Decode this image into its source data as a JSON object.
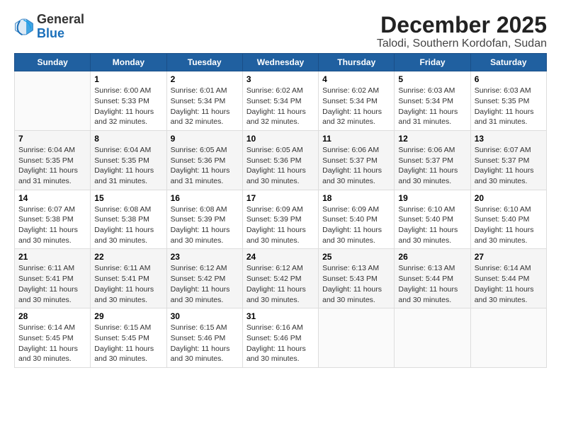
{
  "logo": {
    "general": "General",
    "blue": "Blue"
  },
  "title": "December 2025",
  "subtitle": "Talodi, Southern Kordofan, Sudan",
  "days_header": [
    "Sunday",
    "Monday",
    "Tuesday",
    "Wednesday",
    "Thursday",
    "Friday",
    "Saturday"
  ],
  "weeks": [
    [
      {
        "day": "",
        "info": ""
      },
      {
        "day": "1",
        "info": "Sunrise: 6:00 AM\nSunset: 5:33 PM\nDaylight: 11 hours\nand 32 minutes."
      },
      {
        "day": "2",
        "info": "Sunrise: 6:01 AM\nSunset: 5:34 PM\nDaylight: 11 hours\nand 32 minutes."
      },
      {
        "day": "3",
        "info": "Sunrise: 6:02 AM\nSunset: 5:34 PM\nDaylight: 11 hours\nand 32 minutes."
      },
      {
        "day": "4",
        "info": "Sunrise: 6:02 AM\nSunset: 5:34 PM\nDaylight: 11 hours\nand 32 minutes."
      },
      {
        "day": "5",
        "info": "Sunrise: 6:03 AM\nSunset: 5:34 PM\nDaylight: 11 hours\nand 31 minutes."
      },
      {
        "day": "6",
        "info": "Sunrise: 6:03 AM\nSunset: 5:35 PM\nDaylight: 11 hours\nand 31 minutes."
      }
    ],
    [
      {
        "day": "7",
        "info": "Sunrise: 6:04 AM\nSunset: 5:35 PM\nDaylight: 11 hours\nand 31 minutes."
      },
      {
        "day": "8",
        "info": "Sunrise: 6:04 AM\nSunset: 5:35 PM\nDaylight: 11 hours\nand 31 minutes."
      },
      {
        "day": "9",
        "info": "Sunrise: 6:05 AM\nSunset: 5:36 PM\nDaylight: 11 hours\nand 31 minutes."
      },
      {
        "day": "10",
        "info": "Sunrise: 6:05 AM\nSunset: 5:36 PM\nDaylight: 11 hours\nand 30 minutes."
      },
      {
        "day": "11",
        "info": "Sunrise: 6:06 AM\nSunset: 5:37 PM\nDaylight: 11 hours\nand 30 minutes."
      },
      {
        "day": "12",
        "info": "Sunrise: 6:06 AM\nSunset: 5:37 PM\nDaylight: 11 hours\nand 30 minutes."
      },
      {
        "day": "13",
        "info": "Sunrise: 6:07 AM\nSunset: 5:37 PM\nDaylight: 11 hours\nand 30 minutes."
      }
    ],
    [
      {
        "day": "14",
        "info": "Sunrise: 6:07 AM\nSunset: 5:38 PM\nDaylight: 11 hours\nand 30 minutes."
      },
      {
        "day": "15",
        "info": "Sunrise: 6:08 AM\nSunset: 5:38 PM\nDaylight: 11 hours\nand 30 minutes."
      },
      {
        "day": "16",
        "info": "Sunrise: 6:08 AM\nSunset: 5:39 PM\nDaylight: 11 hours\nand 30 minutes."
      },
      {
        "day": "17",
        "info": "Sunrise: 6:09 AM\nSunset: 5:39 PM\nDaylight: 11 hours\nand 30 minutes."
      },
      {
        "day": "18",
        "info": "Sunrise: 6:09 AM\nSunset: 5:40 PM\nDaylight: 11 hours\nand 30 minutes."
      },
      {
        "day": "19",
        "info": "Sunrise: 6:10 AM\nSunset: 5:40 PM\nDaylight: 11 hours\nand 30 minutes."
      },
      {
        "day": "20",
        "info": "Sunrise: 6:10 AM\nSunset: 5:40 PM\nDaylight: 11 hours\nand 30 minutes."
      }
    ],
    [
      {
        "day": "21",
        "info": "Sunrise: 6:11 AM\nSunset: 5:41 PM\nDaylight: 11 hours\nand 30 minutes."
      },
      {
        "day": "22",
        "info": "Sunrise: 6:11 AM\nSunset: 5:41 PM\nDaylight: 11 hours\nand 30 minutes."
      },
      {
        "day": "23",
        "info": "Sunrise: 6:12 AM\nSunset: 5:42 PM\nDaylight: 11 hours\nand 30 minutes."
      },
      {
        "day": "24",
        "info": "Sunrise: 6:12 AM\nSunset: 5:42 PM\nDaylight: 11 hours\nand 30 minutes."
      },
      {
        "day": "25",
        "info": "Sunrise: 6:13 AM\nSunset: 5:43 PM\nDaylight: 11 hours\nand 30 minutes."
      },
      {
        "day": "26",
        "info": "Sunrise: 6:13 AM\nSunset: 5:44 PM\nDaylight: 11 hours\nand 30 minutes."
      },
      {
        "day": "27",
        "info": "Sunrise: 6:14 AM\nSunset: 5:44 PM\nDaylight: 11 hours\nand 30 minutes."
      }
    ],
    [
      {
        "day": "28",
        "info": "Sunrise: 6:14 AM\nSunset: 5:45 PM\nDaylight: 11 hours\nand 30 minutes."
      },
      {
        "day": "29",
        "info": "Sunrise: 6:15 AM\nSunset: 5:45 PM\nDaylight: 11 hours\nand 30 minutes."
      },
      {
        "day": "30",
        "info": "Sunrise: 6:15 AM\nSunset: 5:46 PM\nDaylight: 11 hours\nand 30 minutes."
      },
      {
        "day": "31",
        "info": "Sunrise: 6:16 AM\nSunset: 5:46 PM\nDaylight: 11 hours\nand 30 minutes."
      },
      {
        "day": "",
        "info": ""
      },
      {
        "day": "",
        "info": ""
      },
      {
        "day": "",
        "info": ""
      }
    ]
  ]
}
